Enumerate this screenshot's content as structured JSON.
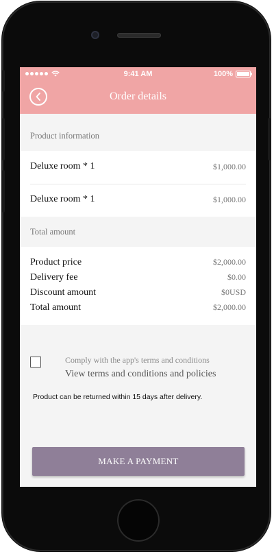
{
  "status_bar": {
    "time": "9:41 AM",
    "battery": "100%",
    "icons": [
      "signal-dots-icon",
      "wifi-icon",
      "battery-icon"
    ]
  },
  "nav": {
    "title": "Order details",
    "back_icon": "chevron-left-circle-icon"
  },
  "product_section": {
    "header": "Product information",
    "items": [
      {
        "name": "Deluxe room * 1",
        "price": "$1,000.00"
      },
      {
        "name": "Deluxe room * 1",
        "price": "$1,000.00"
      }
    ]
  },
  "total_section": {
    "header": "Total amount",
    "lines": [
      {
        "label": "Product price",
        "value": "$2,000.00"
      },
      {
        "label": "Delivery fee",
        "value": "$0.00"
      },
      {
        "label": "Discount amount",
        "value": "$0USD"
      },
      {
        "label": "Total amount",
        "value": "$2,000.00"
      }
    ]
  },
  "terms": {
    "checked": false,
    "label": "Comply with the app's terms and conditions",
    "link": "View terms and conditions and policies"
  },
  "return_note": "Product can be returned within 15 days after delivery.",
  "payment_button": "MAKE A PAYMENT",
  "colors": {
    "header_pink": "#f0a5a5",
    "button_purple": "#8f7f98",
    "screen_bg": "#f4f4f4"
  }
}
